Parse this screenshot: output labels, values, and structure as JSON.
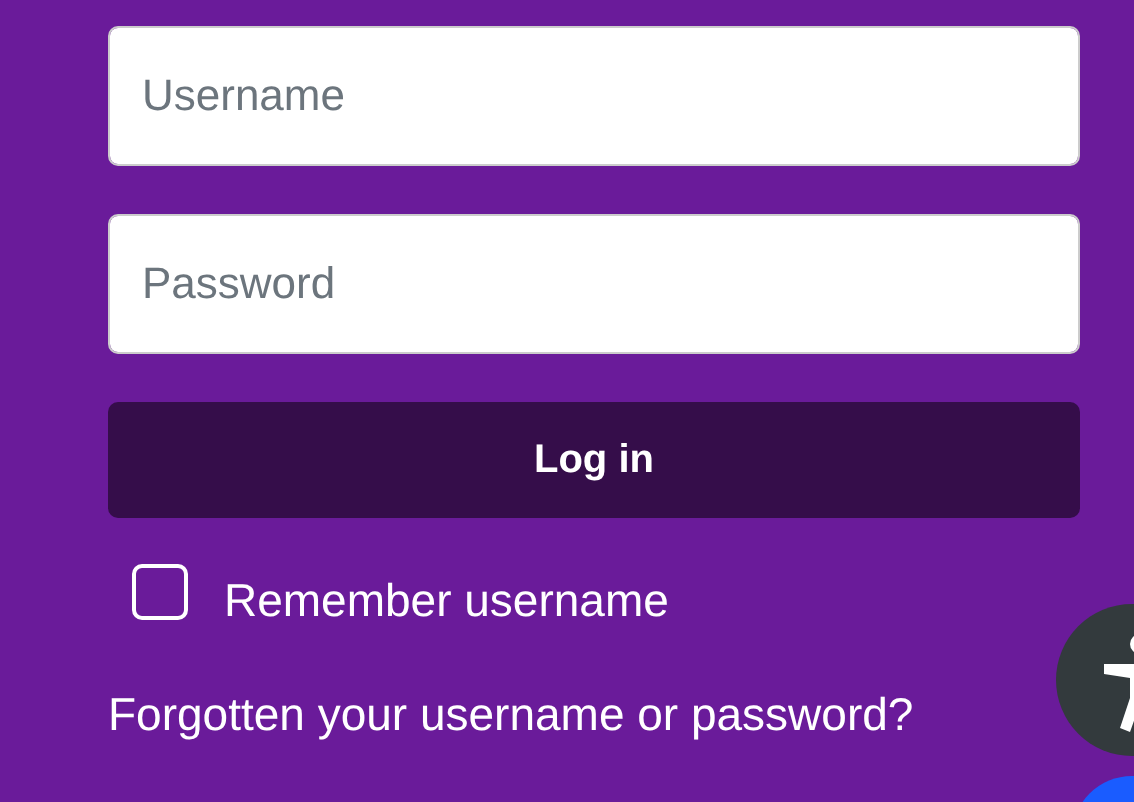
{
  "username_field": {
    "placeholder": "Username"
  },
  "password_field": {
    "placeholder": "Password"
  },
  "login_button": {
    "label": "Log in"
  },
  "remember": {
    "label": "Remember username",
    "checked": false
  },
  "forgot_link": {
    "label": "Forgotten your username or password?"
  }
}
